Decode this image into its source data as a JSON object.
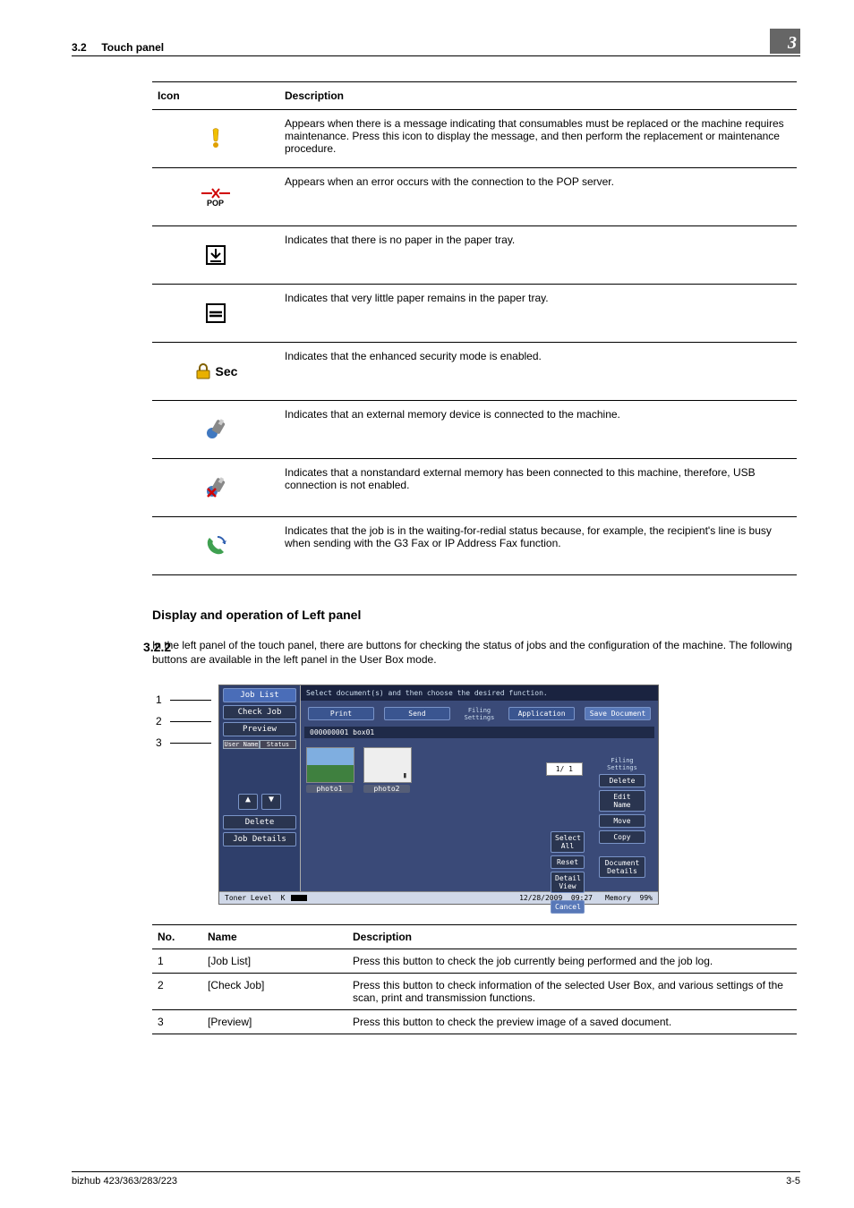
{
  "header": {
    "section": "3.2",
    "title": "Touch panel",
    "chapter": "3"
  },
  "iconTable": {
    "head": {
      "c1": "Icon",
      "c2": "Description"
    },
    "rows": [
      {
        "icon": "attention-icon",
        "desc": "Appears when there is a message indicating that consumables must be replaced or the machine requires maintenance. Press this icon to display the message, and then perform the replacement or maintenance procedure."
      },
      {
        "icon": "pop-error-icon",
        "desc": "Appears when an error occurs with the connection to the POP server."
      },
      {
        "icon": "no-paper-icon",
        "desc": "Indicates that there is no paper in the paper tray."
      },
      {
        "icon": "low-paper-icon",
        "desc": "Indicates that very little paper remains in the paper tray."
      },
      {
        "icon": "security-icon",
        "label": "Sec",
        "desc": "Indicates that the enhanced security mode is enabled."
      },
      {
        "icon": "external-memory-icon",
        "desc": "Indicates that an external memory device is connected to the machine."
      },
      {
        "icon": "external-memory-warn-icon",
        "desc": "Indicates that a nonstandard external memory has been connected to this machine, therefore, USB connection is not enabled."
      },
      {
        "icon": "redial-wait-icon",
        "desc": "Indicates that the job is in the waiting-for-redial status because, for example, the recipient's line is busy when sending with the G3 Fax or IP Address Fax function."
      }
    ]
  },
  "section": {
    "num": "3.2.2",
    "title": "Display and operation of Left panel",
    "body": "In the left panel of the touch panel, there are buttons for checking the status of jobs and the configuration of the machine. The following buttons are available in the left panel in the User Box mode."
  },
  "callouts": [
    "1",
    "2",
    "3"
  ],
  "screenshot": {
    "jobList": "Job List",
    "checkJob": "Check Job",
    "preview": "Preview",
    "userName": "User Name",
    "status": "Status",
    "delete": "Delete",
    "jobDetails": "Job Details",
    "tonerLevel": "Toner Level",
    "instr": "Select document(s) and then choose the desired function.",
    "tabs": {
      "print": "Print",
      "send": "Send",
      "filing": "Filing Settings",
      "app": "Application",
      "save": "Save Document"
    },
    "bar": "000000001   box01",
    "thumb1": "photo1",
    "thumb2": "photo2",
    "page": "1/  1",
    "rbtns": {
      "filing": "Filing Settings",
      "del": "Delete",
      "edit": "Edit Name",
      "move": "Move",
      "copy": "Copy",
      "docdet": "Document Details"
    },
    "mbtns": {
      "selall": "Select All",
      "reset": "Reset",
      "detail": "Detail View",
      "cancel": "Cancel"
    },
    "tonerK": "K",
    "footer": {
      "date": "12/28/2009",
      "time": "09:27",
      "mem": "Memory",
      "pct": "99%"
    }
  },
  "numTable": {
    "head": {
      "c1": "No.",
      "c2": "Name",
      "c3": "Description"
    },
    "rows": [
      {
        "n": "1",
        "name": "[Job List]",
        "desc": "Press this button to check the job currently being performed and the job log."
      },
      {
        "n": "2",
        "name": "[Check Job]",
        "desc": "Press this button to check information of the selected User Box, and various settings of the scan, print and transmission functions."
      },
      {
        "n": "3",
        "name": "[Preview]",
        "desc": "Press this button to check the preview image of a saved document."
      }
    ]
  },
  "footer": {
    "left": "bizhub 423/363/283/223",
    "right": "3-5"
  }
}
